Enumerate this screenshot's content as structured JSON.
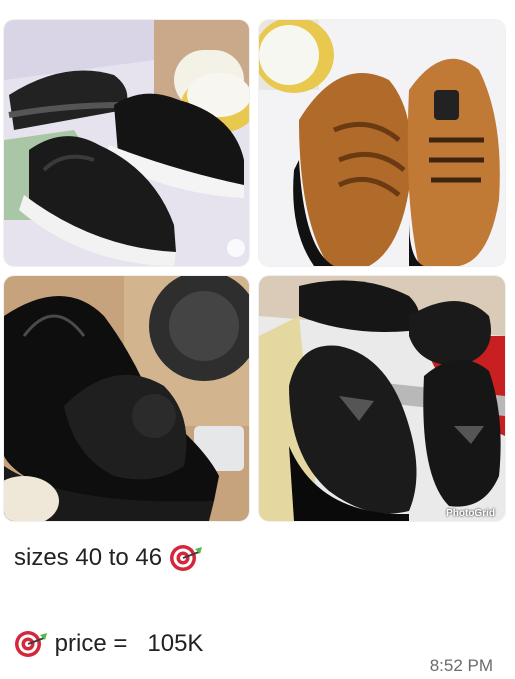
{
  "message": {
    "photos": [
      {
        "name": "black-leather-sneakers-photo"
      },
      {
        "name": "brown-leather-sneakers-photo"
      },
      {
        "name": "black-patent-medusa-sneaker-photo"
      },
      {
        "name": "black-v-buckle-loafers-photo"
      }
    ],
    "watermark": "PhotoGrid",
    "sizes_text": "sizes 40 to 46 ",
    "price_text": " price =   105K",
    "icon": "direct-hit-target-icon",
    "time": "8:52 PM"
  },
  "colors": {
    "bubble_bg": "#ffffff",
    "text": "#222222",
    "timestamp": "#6b6b6b"
  }
}
